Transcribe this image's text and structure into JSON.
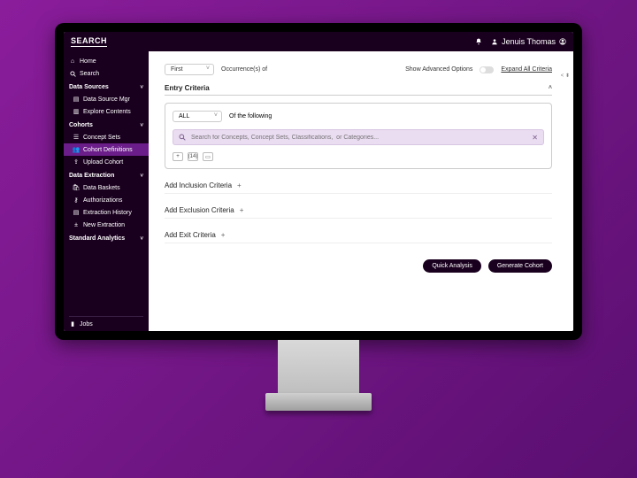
{
  "topbar": {
    "brand": "SEARCH",
    "user_name": "Jenuis Thomas"
  },
  "sidebar": {
    "home": "Home",
    "search": "Search",
    "data_sources_head": "Data Sources",
    "data_source_mgr": "Data Source Mgr",
    "explore_contents": "Explore Contents",
    "cohorts_head": "Cohorts",
    "concept_sets": "Concept Sets",
    "cohort_definitions": "Cohort Definitions",
    "upload_cohort": "Upload Cohort",
    "data_extraction_head": "Data Extraction",
    "data_baskets": "Data Baskets",
    "authorizations": "Authorizations",
    "extraction_history": "Extraction History",
    "new_extraction": "New Extraction",
    "standard_analytics_head": "Standard Analytics",
    "jobs": "Jobs"
  },
  "main": {
    "occurrence_select": "First",
    "occurrence_suffix": "Occurrence(s) of",
    "show_advanced": "Show Advanced Options",
    "expand_all": "Expand All Criteria",
    "entry_heading": "Entry Criteria",
    "all_select": "ALL",
    "of_following": "Of the following",
    "search_placeholder": "Search for Concepts, Concept Sets, Classifications,  or Categories...",
    "pill_plus": "+",
    "pill_days": "(14)",
    "pill_cal": "▭",
    "add_inclusion": "Add Inclusion Criteria",
    "add_exclusion": "Add Exclusion Criteria",
    "add_exit": "Add Exit Criteria",
    "btn_quick": "Quick Analysis",
    "btn_generate": "Generate Cohort",
    "side_tag": "< ⬍"
  }
}
